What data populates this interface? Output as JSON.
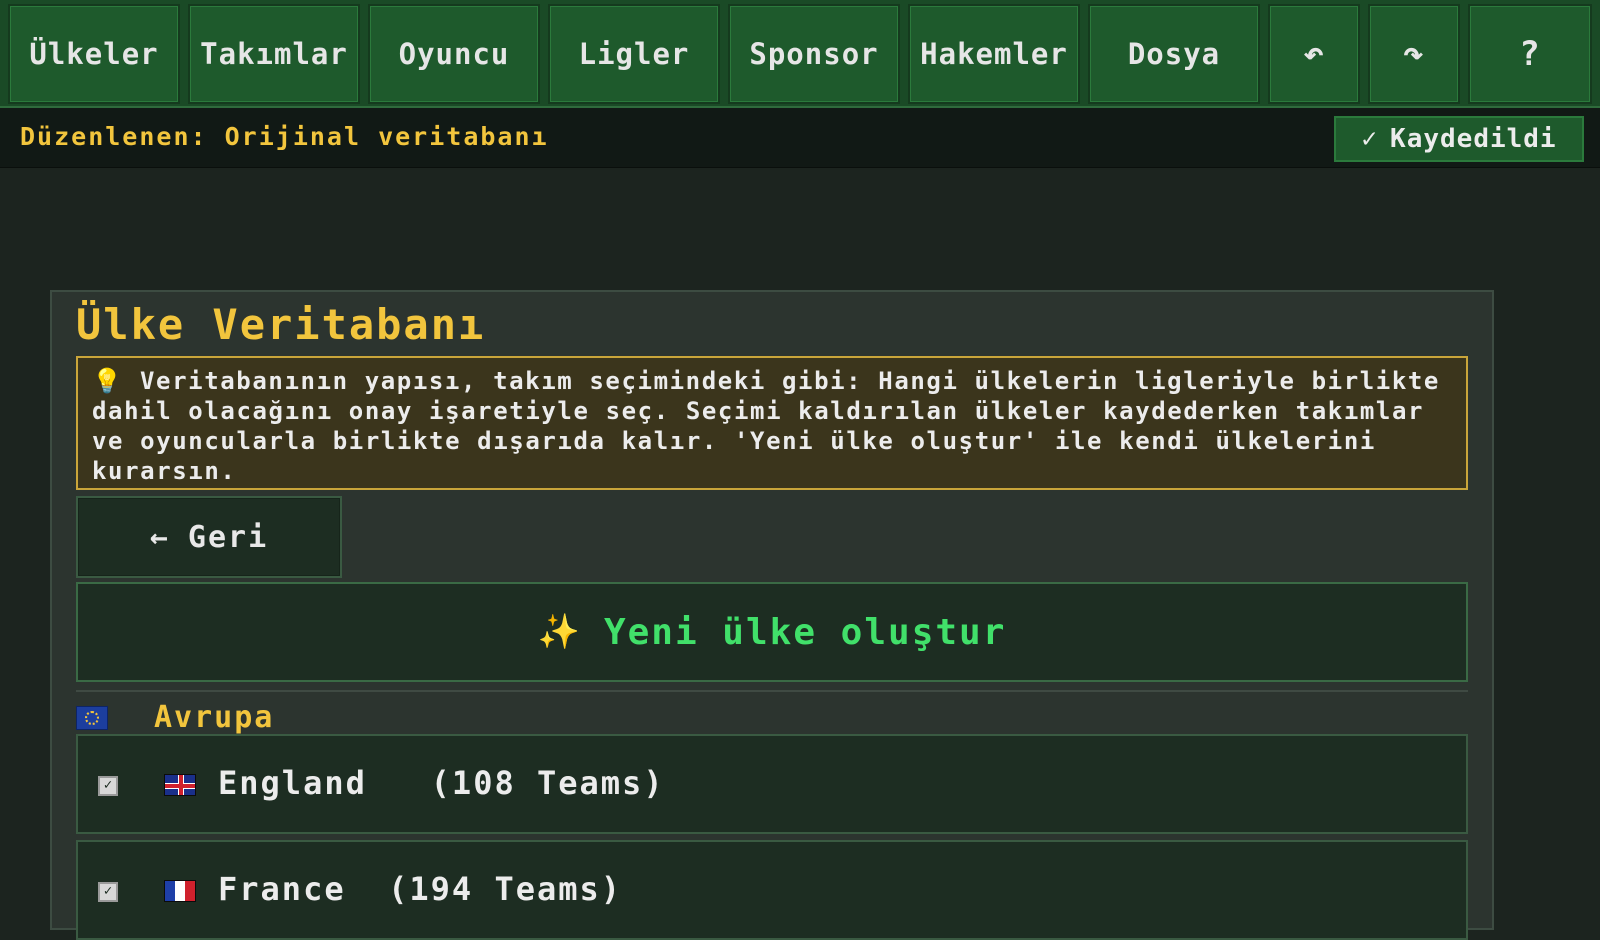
{
  "nav": {
    "items": [
      {
        "label": "Ülkeler"
      },
      {
        "label": "Takımlar"
      },
      {
        "label": "Oyuncu"
      },
      {
        "label": "Ligler"
      },
      {
        "label": "Sponsor"
      },
      {
        "label": "Hakemler"
      },
      {
        "label": "Dosya"
      }
    ],
    "undo_icon": "↶",
    "redo_icon": "↷",
    "help_label": "?"
  },
  "status": {
    "text": "Düzenlenen: Orijinal veritabanı",
    "saved_icon": "✓",
    "saved_label": "Kaydedildi"
  },
  "panel": {
    "title": "Ülke Veritabanı",
    "info_icon": "💡",
    "info_text": "Veritabanının yapısı, takım seçimindeki gibi: Hangi ülkelerin ligleriyle birlikte dahil olacağını onay işaretiyle seç. Seçimi kaldırılan ülkeler kaydederken takımlar ve oyuncularla birlikte dışarıda kalır. 'Yeni ülke oluştur' ile kendi ülkelerini kurarsın.",
    "back_icon": "←",
    "back_label": "Geri",
    "create_icon": "✨",
    "create_label": "Yeni ülke oluştur",
    "region": "Avrupa",
    "countries": [
      {
        "name": "England",
        "teams": "(108 Teams)",
        "checked": true
      },
      {
        "name": "France",
        "teams": "(194 Teams)",
        "checked": true
      }
    ]
  }
}
